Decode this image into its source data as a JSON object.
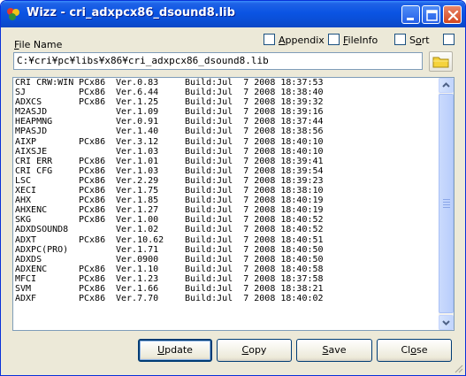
{
  "window": {
    "title": "Wizz - cri_adxpcx86_dsound8.lib"
  },
  "form": {
    "file_name_label": "File Name",
    "path_value": "C:¥cri¥pc¥libs¥x86¥cri_adxpcx86_dsound8.lib",
    "checks": [
      {
        "label": "Appendix",
        "checked": false
      },
      {
        "label": "FileInfo",
        "checked": false
      },
      {
        "label": "Sort",
        "checked": false
      }
    ]
  },
  "list": {
    "rows": [
      {
        "name": "CRI CRW:WIN",
        "platform": "PCx86",
        "version": "Ver.0.83",
        "build": "Build:Jul  7 2008 18:37:53"
      },
      {
        "name": "SJ",
        "platform": "PCx86",
        "version": "Ver.6.44",
        "build": "Build:Jul  7 2008 18:38:40"
      },
      {
        "name": "ADXCS",
        "platform": "PCx86",
        "version": "Ver.1.25",
        "build": "Build:Jul  7 2008 18:39:32"
      },
      {
        "name": "M2ASJD",
        "platform": "",
        "version": "Ver.1.09",
        "build": "Build:Jul  7 2008 18:39:16"
      },
      {
        "name": "HEAPMNG",
        "platform": "",
        "version": "Ver.0.91",
        "build": "Build:Jul  7 2008 18:37:44"
      },
      {
        "name": "MPASJD",
        "platform": "",
        "version": "Ver.1.40",
        "build": "Build:Jul  7 2008 18:38:56"
      },
      {
        "name": "AIXP",
        "platform": "PCx86",
        "version": "Ver.3.12",
        "build": "Build:Jul  7 2008 18:40:10"
      },
      {
        "name": "AIXSJE",
        "platform": "",
        "version": "Ver.1.03",
        "build": "Build:Jul  7 2008 18:40:10"
      },
      {
        "name": "CRI ERR",
        "platform": "PCx86",
        "version": "Ver.1.01",
        "build": "Build:Jul  7 2008 18:39:41"
      },
      {
        "name": "CRI CFG",
        "platform": "PCx86",
        "version": "Ver.1.03",
        "build": "Build:Jul  7 2008 18:39:54"
      },
      {
        "name": "LSC",
        "platform": "PCx86",
        "version": "Ver.2.29",
        "build": "Build:Jul  7 2008 18:39:23"
      },
      {
        "name": "XECI",
        "platform": "PCx86",
        "version": "Ver.1.75",
        "build": "Build:Jul  7 2008 18:38:10"
      },
      {
        "name": "AHX",
        "platform": "PCx86",
        "version": "Ver.1.85",
        "build": "Build:Jul  7 2008 18:40:19"
      },
      {
        "name": "AHXENC",
        "platform": "PCx86",
        "version": "Ver.1.27",
        "build": "Build:Jul  7 2008 18:40:19"
      },
      {
        "name": "SKG",
        "platform": "PCx86",
        "version": "Ver.1.00",
        "build": "Build:Jul  7 2008 18:40:52"
      },
      {
        "name": "ADXDSOUND8",
        "platform": "",
        "version": "Ver.1.02",
        "build": "Build:Jul  7 2008 18:40:52"
      },
      {
        "name": "ADXT",
        "platform": "PCx86",
        "version": "Ver.10.62",
        "build": "Build:Jul  7 2008 18:40:51"
      },
      {
        "name": "ADXPC(PRO)",
        "platform": "",
        "version": "Ver.1.71",
        "build": "Build:Jul  7 2008 18:40:50"
      },
      {
        "name": "ADXDS",
        "platform": "",
        "version": "Ver.0900",
        "build": "Build:Jul  7 2008 18:40:50"
      },
      {
        "name": "ADXENC",
        "platform": "PCx86",
        "version": "Ver.1.10",
        "build": "Build:Jul  7 2008 18:40:58"
      },
      {
        "name": "MFCI",
        "platform": "PCx86",
        "version": "Ver.1.23",
        "build": "Build:Jul  7 2008 18:37:58"
      },
      {
        "name": "SVM",
        "platform": "PCx86",
        "version": "Ver.1.66",
        "build": "Build:Jul  7 2008 18:38:21"
      },
      {
        "name": "ADXF",
        "platform": "PCx86",
        "version": "Ver.7.70",
        "build": "Build:Jul  7 2008 18:40:02"
      }
    ]
  },
  "buttons": {
    "update": "Update",
    "copy": "Copy",
    "save": "Save",
    "close": "Close"
  },
  "icons": {
    "app": "wizz-app-icon",
    "folder": "folder-icon"
  },
  "colors": {
    "titlebar": "#0a54e3",
    "window_bg": "#ece9d8",
    "folder": "#f5d33c"
  }
}
